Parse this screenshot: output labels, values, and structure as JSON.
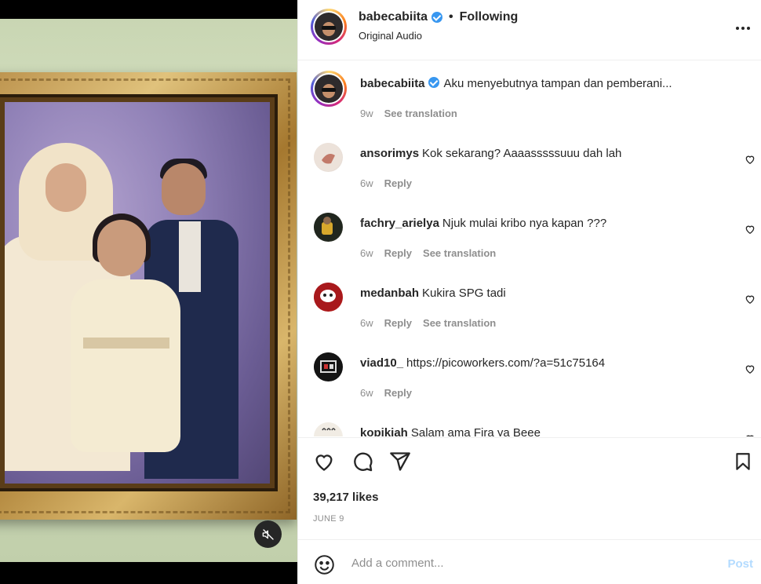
{
  "header": {
    "username": "babecabiita",
    "separator": "•",
    "follow_status": "Following",
    "subtitle": "Original Audio",
    "more_label": "•••"
  },
  "caption": {
    "username": "babecabiita",
    "text": "Aku menyebutnya tampan dan pemberani...",
    "time": "9w",
    "see_translation": "See translation"
  },
  "comments": [
    {
      "username": "ansorimys",
      "text": "Kok sekarang? Aaaasssssuuu dah lah",
      "time": "6w",
      "reply": "Reply",
      "translation": ""
    },
    {
      "username": "fachry_arielya",
      "text": "Njuk mulai kribo nya kapan ???",
      "time": "6w",
      "reply": "Reply",
      "translation": "See translation"
    },
    {
      "username": "medanbah",
      "text": "Kukira SPG tadi",
      "time": "6w",
      "reply": "Reply",
      "translation": "See translation"
    },
    {
      "username": "viad10_",
      "text": "https://picoworkers.com/?a=51c75164",
      "time": "6w",
      "reply": "Reply",
      "translation": ""
    },
    {
      "username": "kopikiah",
      "text": "Salam ama Fira ya Beee",
      "time": "",
      "reply": "",
      "translation": ""
    }
  ],
  "actions": {
    "likes": "39,217 likes",
    "date": "JUNE 9"
  },
  "comment_box": {
    "placeholder": "Add a comment...",
    "post_label": "Post"
  },
  "icons": {
    "like": "heart-icon",
    "comment": "comment-bubble-icon",
    "share": "paper-plane-icon",
    "save": "bookmark-icon",
    "emoji": "smiley-icon",
    "mute": "speaker-muted-icon",
    "verified": "verified-badge-icon"
  },
  "colors": {
    "text": "#262626",
    "secondary": "#8e8e8e",
    "verified": "#3897f0",
    "post_disabled": "#b3dbff"
  }
}
